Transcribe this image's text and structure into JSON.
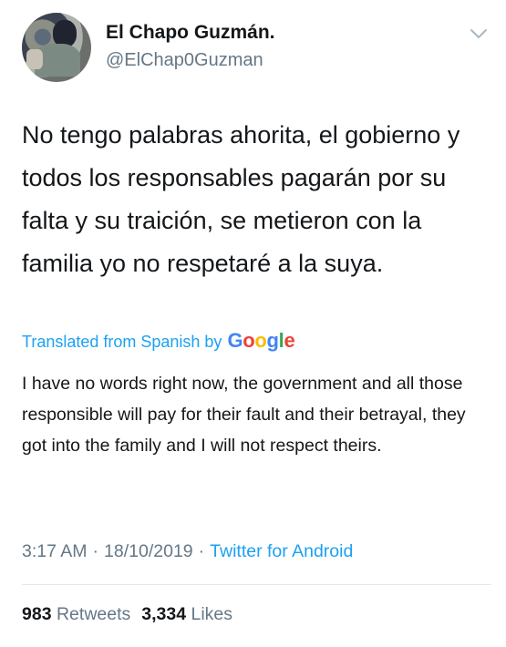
{
  "user": {
    "name": "El Chapo Guzmán.",
    "handle": "@ElChap0Guzman"
  },
  "tweet": {
    "text": "No tengo palabras ahorita, el gobierno y todos los responsables pagarán por su falta y su traición, se metieron con la familia yo no respetaré a la suya."
  },
  "translation": {
    "label": "Translated from Spanish by",
    "provider_letters": [
      "G",
      "o",
      "o",
      "g",
      "l",
      "e"
    ],
    "text": "I have no words right now, the government and all those responsible will pay for their fault and their betrayal, they got into the family and I will not respect theirs."
  },
  "meta": {
    "time": "3:17 AM",
    "separator": "·",
    "date": "18/10/2019",
    "source": "Twitter for Android"
  },
  "stats": {
    "retweets_count": "983",
    "retweets_label": "Retweets",
    "likes_count": "3,334",
    "likes_label": "Likes"
  },
  "icons": {
    "chevron": "chevron-down-icon",
    "avatar": "user-avatar"
  },
  "colors": {
    "link": "#1da1f2",
    "secondary_text": "#657786",
    "primary_text": "#14171a",
    "divider": "#e1e8ed"
  }
}
